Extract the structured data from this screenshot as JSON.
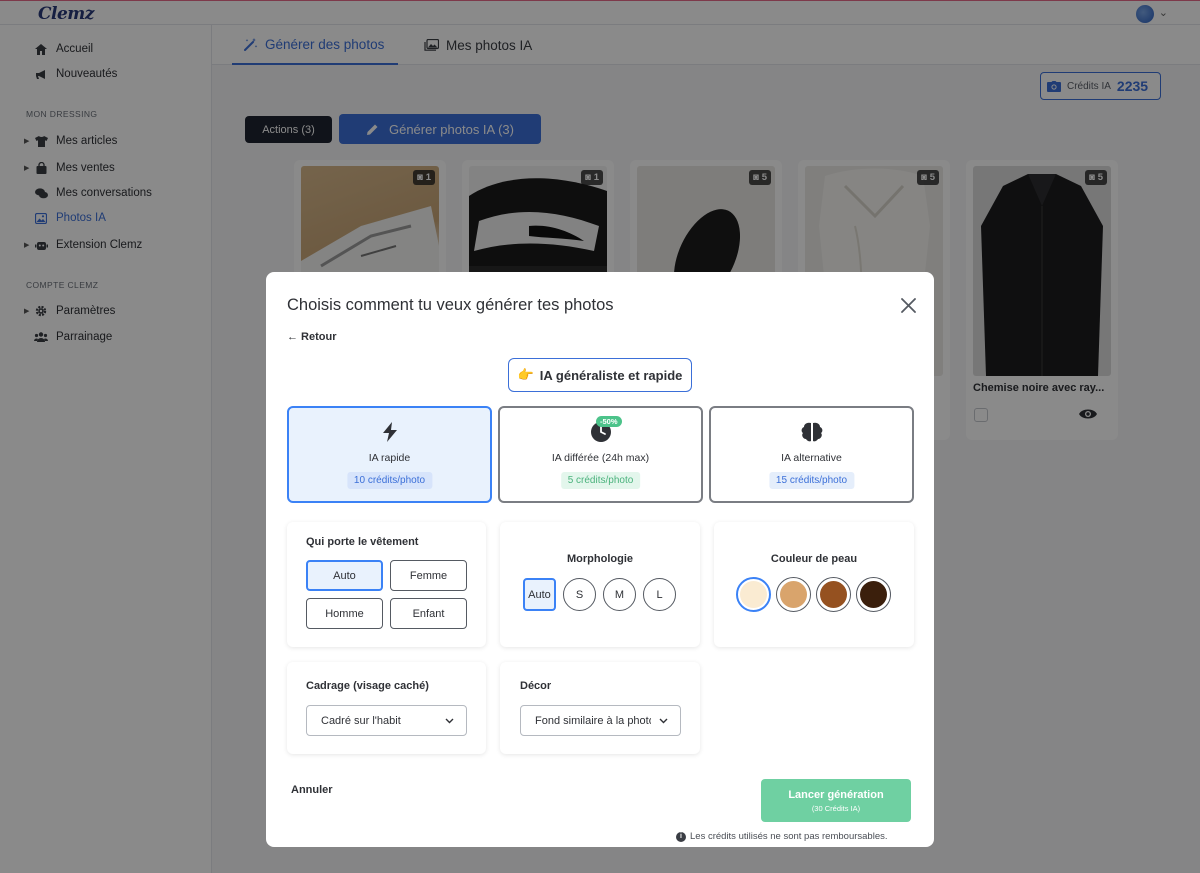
{
  "app": {
    "logo": "Clemz"
  },
  "sidebar": {
    "top_items": [
      {
        "label": "Accueil",
        "icon": "home-icon"
      },
      {
        "label": "Nouveautés",
        "icon": "megaphone-icon"
      }
    ],
    "section_dressing": "MON DRESSING",
    "dressing_items": [
      {
        "label": "Mes articles",
        "icon": "tshirt-icon"
      },
      {
        "label": "Mes ventes",
        "icon": "bag-icon"
      },
      {
        "label": "Mes conversations",
        "icon": "chat-icon"
      },
      {
        "label": "Photos IA",
        "icon": "image-icon"
      },
      {
        "label": "Extension Clemz",
        "icon": "robot-icon"
      }
    ],
    "section_compte": "COMPTE CLEMZ",
    "compte_items": [
      {
        "label": "Paramètres",
        "icon": "gear-icon"
      },
      {
        "label": "Parrainage",
        "icon": "users-icon"
      }
    ]
  },
  "tabs": [
    {
      "label": "Générer des photos",
      "icon": "magic-wand-icon"
    },
    {
      "label": "Mes photos IA",
      "icon": "images-icon"
    }
  ],
  "credits": {
    "label": "Crédits IA",
    "value": "2235"
  },
  "toolbar": {
    "actions_label": "Actions (3)",
    "generate_label": "Générer photos IA (3)"
  },
  "cards": [
    {
      "count": "1",
      "title": ""
    },
    {
      "count": "1",
      "title": ""
    },
    {
      "count": "5",
      "title": ""
    },
    {
      "count": "5",
      "title": ""
    },
    {
      "count": "5",
      "title": "Chemise noire avec ray..."
    }
  ],
  "modal": {
    "title": "Choisis comment tu veux générer tes photos",
    "back": "← Retour",
    "mode_pill": "IA généraliste et rapide",
    "options": [
      {
        "label": "IA rapide",
        "price": "10 crédits/photo",
        "icon": "lightning-icon"
      },
      {
        "label": "IA différée (24h max)",
        "price": "5 crédits/photo",
        "badge": "-50%",
        "icon": "clock-icon"
      },
      {
        "label": "IA alternative",
        "price": "15 crédits/photo",
        "icon": "brain-icon"
      }
    ],
    "wearer": {
      "title": "Qui porte le vêtement",
      "options": [
        "Auto",
        "Femme",
        "Homme",
        "Enfant"
      ],
      "selected": "Auto"
    },
    "morphology": {
      "title": "Morphologie",
      "options": [
        "Auto",
        "S",
        "M",
        "L"
      ],
      "selected": "Auto"
    },
    "skin": {
      "title": "Couleur de peau",
      "colors": [
        "#faebd2",
        "#d9a46c",
        "#955120",
        "#3b1f0c"
      ],
      "selected": 0
    },
    "framing": {
      "title": "Cadrage (visage caché)",
      "value": "Cadré sur l'habit"
    },
    "decor": {
      "title": "Décor",
      "value": "Fond similaire à la photo"
    },
    "cancel": "Annuler",
    "launch": {
      "label": "Lancer génération",
      "sub": "(30 Crédits IA)"
    },
    "note": "Les crédits utilisés ne sont pas remboursables."
  },
  "colors": {
    "accent": "#3b6fd8",
    "selected_border": "#3b82f6",
    "launch_green": "#6fd0a2"
  }
}
